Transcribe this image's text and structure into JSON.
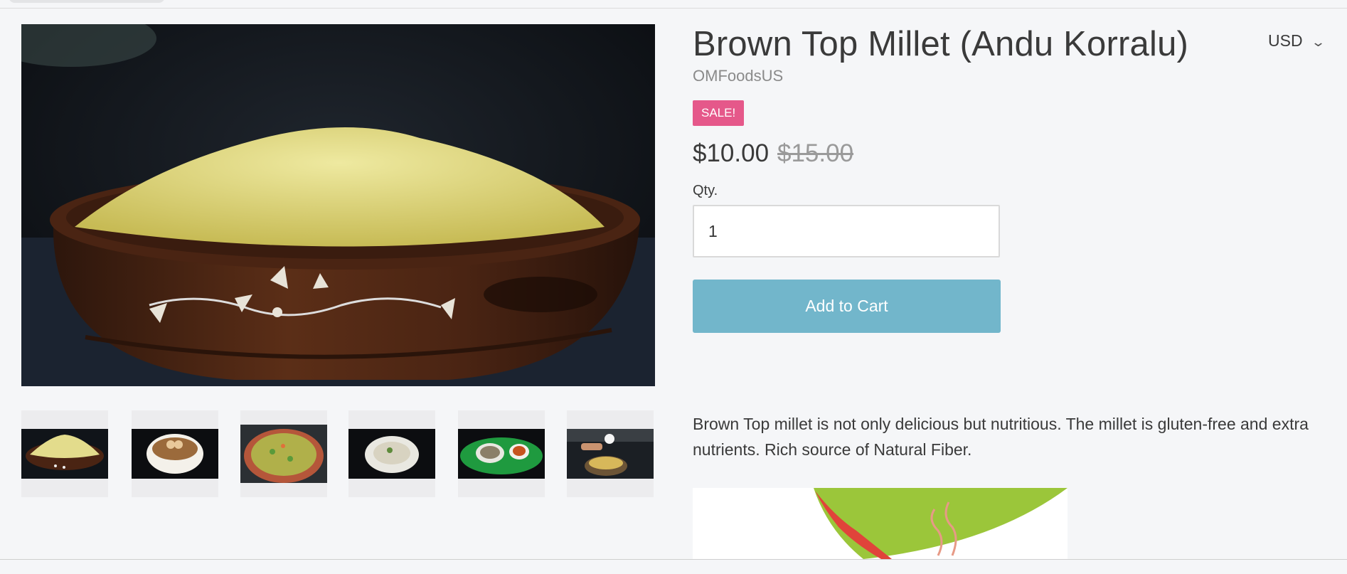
{
  "product": {
    "title": "Brown Top Millet (Andu Korralu)",
    "vendor": "OMFoodsUS",
    "sale_badge": "SALE!",
    "price": "$10.00",
    "compare_at_price": "$15.00",
    "quantity_label": "Qty.",
    "quantity_value": "1",
    "add_to_cart_label": "Add to Cart",
    "description": "Brown Top millet is not only delicious but nutritious. The millet is gluten-free and extra nutrients. Rich source of Natural Fiber."
  },
  "currency": {
    "selected": "USD",
    "chevron_icon": "chevron-down-icon"
  },
  "colors": {
    "sale_badge": "#e5588a",
    "add_to_cart": "#72b6cb",
    "background": "#f5f6f8"
  },
  "gallery": {
    "main_image": "millet-bowl",
    "thumbnails": [
      "millet-bowl",
      "curry-bowl",
      "vegetable-rice-pot",
      "porridge-plate",
      "leaf-plate-meal",
      "cooking-pot"
    ]
  }
}
